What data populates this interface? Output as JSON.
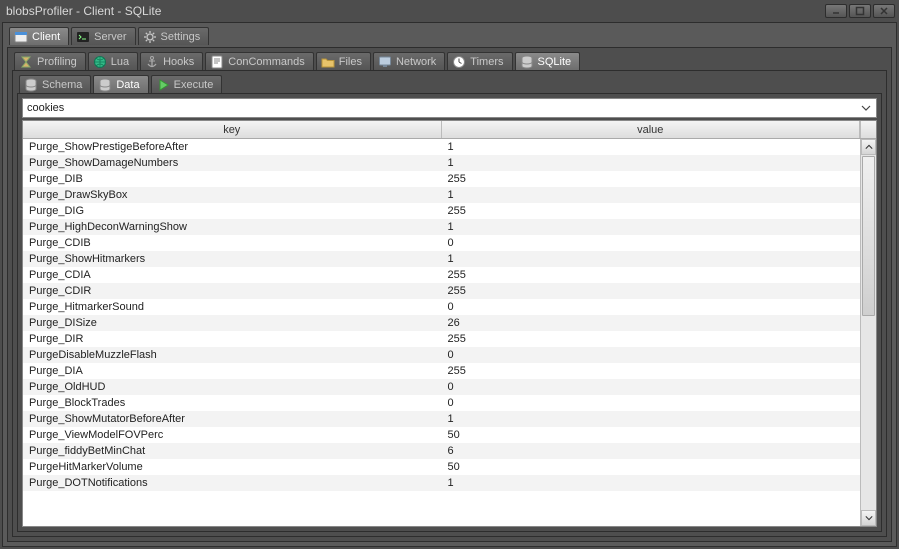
{
  "window": {
    "title": "blobsProfiler - Client - SQLite"
  },
  "primaryTabs": [
    {
      "label": "Client",
      "active": true
    },
    {
      "label": "Server",
      "active": false
    },
    {
      "label": "Settings",
      "active": false
    }
  ],
  "secondaryTabs": [
    {
      "label": "Profiling",
      "active": false
    },
    {
      "label": "Lua",
      "active": false
    },
    {
      "label": "Hooks",
      "active": false
    },
    {
      "label": "ConCommands",
      "active": false
    },
    {
      "label": "Files",
      "active": false
    },
    {
      "label": "Network",
      "active": false
    },
    {
      "label": "Timers",
      "active": false
    },
    {
      "label": "SQLite",
      "active": true
    }
  ],
  "tertiaryTabs": [
    {
      "label": "Schema",
      "active": false
    },
    {
      "label": "Data",
      "active": true
    },
    {
      "label": "Execute",
      "active": false
    }
  ],
  "combo": {
    "value": "cookies"
  },
  "columns": [
    "key",
    "value"
  ],
  "rows": [
    {
      "key": "Purge_ShowPrestigeBeforeAfter",
      "value": "1"
    },
    {
      "key": "Purge_ShowDamageNumbers",
      "value": "1"
    },
    {
      "key": "Purge_DIB",
      "value": "255"
    },
    {
      "key": "Purge_DrawSkyBox",
      "value": "1"
    },
    {
      "key": "Purge_DIG",
      "value": "255"
    },
    {
      "key": "Purge_HighDeconWarningShow",
      "value": "1"
    },
    {
      "key": "Purge_CDIB",
      "value": "0"
    },
    {
      "key": "Purge_ShowHitmarkers",
      "value": "1"
    },
    {
      "key": "Purge_CDIA",
      "value": "255"
    },
    {
      "key": "Purge_CDIR",
      "value": "255"
    },
    {
      "key": "Purge_HitmarkerSound",
      "value": "0"
    },
    {
      "key": "Purge_DISize",
      "value": "26"
    },
    {
      "key": "Purge_DIR",
      "value": "255"
    },
    {
      "key": "PurgeDisableMuzzleFlash",
      "value": "0"
    },
    {
      "key": "Purge_DIA",
      "value": "255"
    },
    {
      "key": "Purge_OldHUD",
      "value": "0"
    },
    {
      "key": "Purge_BlockTrades",
      "value": "0"
    },
    {
      "key": "Purge_ShowMutatorBeforeAfter",
      "value": "1"
    },
    {
      "key": "Purge_ViewModelFOVPerc",
      "value": "50"
    },
    {
      "key": "Purge_fiddyBetMinChat",
      "value": "6"
    },
    {
      "key": "PurgeHitMarkerVolume",
      "value": "50"
    },
    {
      "key": "Purge_DOTNotifications",
      "value": "1"
    }
  ],
  "icons": {
    "client": "app",
    "server": "terminal",
    "settings": "gear",
    "profiling": "hourglass",
    "lua": "globe",
    "hooks": "anchor",
    "concommands": "script",
    "files": "folder",
    "network": "monitor",
    "timers": "clock",
    "sqlite": "database",
    "schema": "database",
    "data": "database",
    "execute": "play"
  }
}
